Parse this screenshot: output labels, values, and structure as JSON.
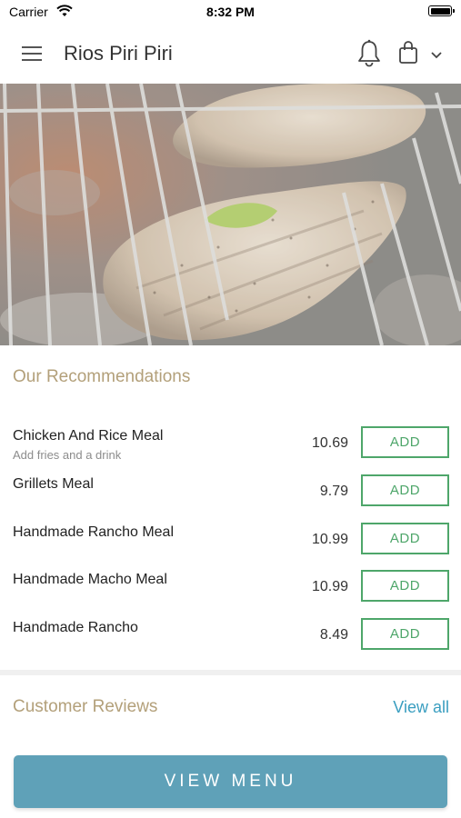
{
  "status_bar": {
    "carrier": "Carrier",
    "time": "8:32 PM"
  },
  "header": {
    "title": "Rios Piri Piri",
    "icons": [
      "menu-icon",
      "bell-icon",
      "shopping-bag-icon",
      "chevron-down-icon"
    ]
  },
  "hero": {
    "image": "grilled-chicken-breast-on-grill"
  },
  "recommendations": {
    "title": "Our Recommendations",
    "items": [
      {
        "name": "Chicken And Rice Meal",
        "description": "Add fries and a drink",
        "price": "10.69",
        "button": "ADD"
      },
      {
        "name": "Grillets Meal",
        "description": "",
        "price": "9.79",
        "button": "ADD"
      },
      {
        "name": "Handmade Rancho Meal",
        "description": "",
        "price": "10.99",
        "button": "ADD"
      },
      {
        "name": "Handmade Macho Meal",
        "description": "",
        "price": "10.99",
        "button": "ADD"
      },
      {
        "name": "Handmade Rancho",
        "description": "",
        "price": "8.49",
        "button": "ADD"
      }
    ]
  },
  "reviews": {
    "title": "Customer Reviews",
    "view_all": "View all"
  },
  "footer": {
    "button": "VIEW MENU"
  },
  "colors": {
    "accent_gold": "#b3a07a",
    "add_green": "#4ea66a",
    "link_blue": "#3a9ec0",
    "button_teal": "#5fa1b8"
  }
}
